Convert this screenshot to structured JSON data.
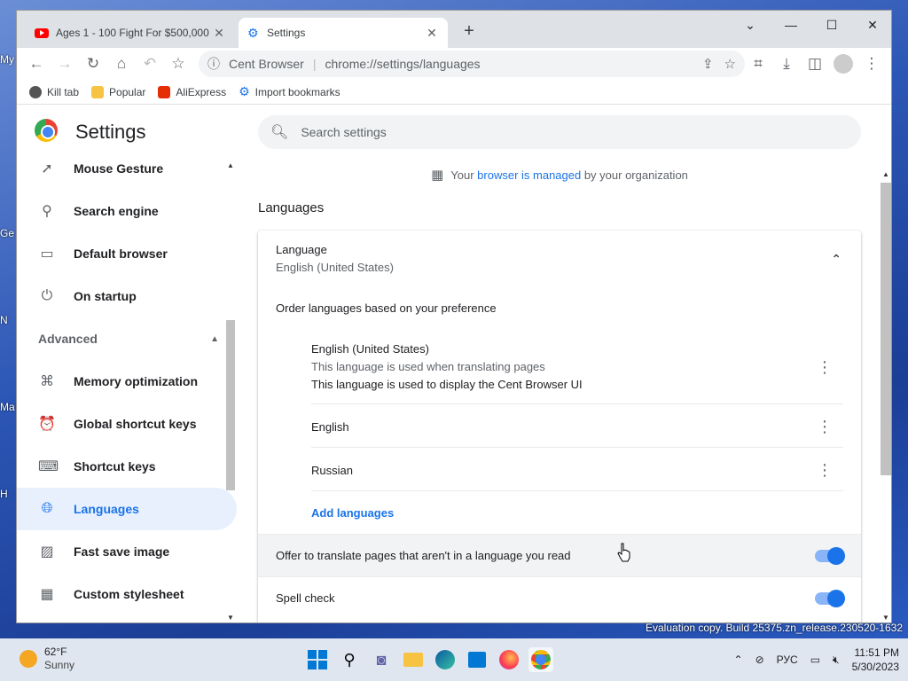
{
  "browser": {
    "tabs": [
      {
        "title": "Ages 1 - 100 Fight For $500,000",
        "close": "✕",
        "active": false
      },
      {
        "title": "Settings",
        "close": "✕",
        "active": true
      }
    ],
    "new_tab": "+",
    "window_controls": {
      "dropdown": "⌄",
      "minimize": "—",
      "maximize": "☐",
      "close": "✕"
    },
    "omnibox": {
      "site": "Cent Browser",
      "separator": "|",
      "url": "chrome://settings/languages"
    },
    "bookmarks": [
      "Kill tab",
      "Popular",
      "AliExpress",
      "Import bookmarks"
    ]
  },
  "settings": {
    "title": "Settings",
    "search_placeholder": "Search settings",
    "sidebar": {
      "items_top": [
        "Mouse Gesture",
        "Search engine",
        "Default browser",
        "On startup"
      ],
      "section": "Advanced",
      "items_advanced": [
        "Memory optimization",
        "Global shortcut keys",
        "Shortcut keys",
        "Languages",
        "Fast save image",
        "Custom stylesheet"
      ],
      "selected": "Languages"
    },
    "managed": {
      "prefix": "Your ",
      "link": "browser is managed",
      "suffix": " by your organization"
    },
    "section_title": "Languages",
    "language_card": {
      "heading": "Language",
      "current": "English (United States)",
      "order_label": "Order languages based on your preference",
      "languages": [
        {
          "name": "English (United States)",
          "note1": "This language is used when translating pages",
          "note2": "This language is used to display the Cent Browser UI"
        },
        {
          "name": "English"
        },
        {
          "name": "Russian"
        }
      ],
      "add_languages": "Add languages",
      "offer_translate": "Offer to translate pages that aren't in a language you read",
      "spell_check": "Spell check",
      "offer_translate_on": true,
      "spell_check_on": true
    }
  },
  "desktop": {
    "labels": [
      "My",
      "Ge",
      "N",
      "Ma",
      "H"
    ],
    "watermark": "Evaluation copy. Build 25375.zn_release.230520-1632"
  },
  "taskbar": {
    "weather_temp": "62°F",
    "weather_cond": "Sunny",
    "lang": "РУС",
    "time": "11:51 PM",
    "date": "5/30/2023"
  }
}
